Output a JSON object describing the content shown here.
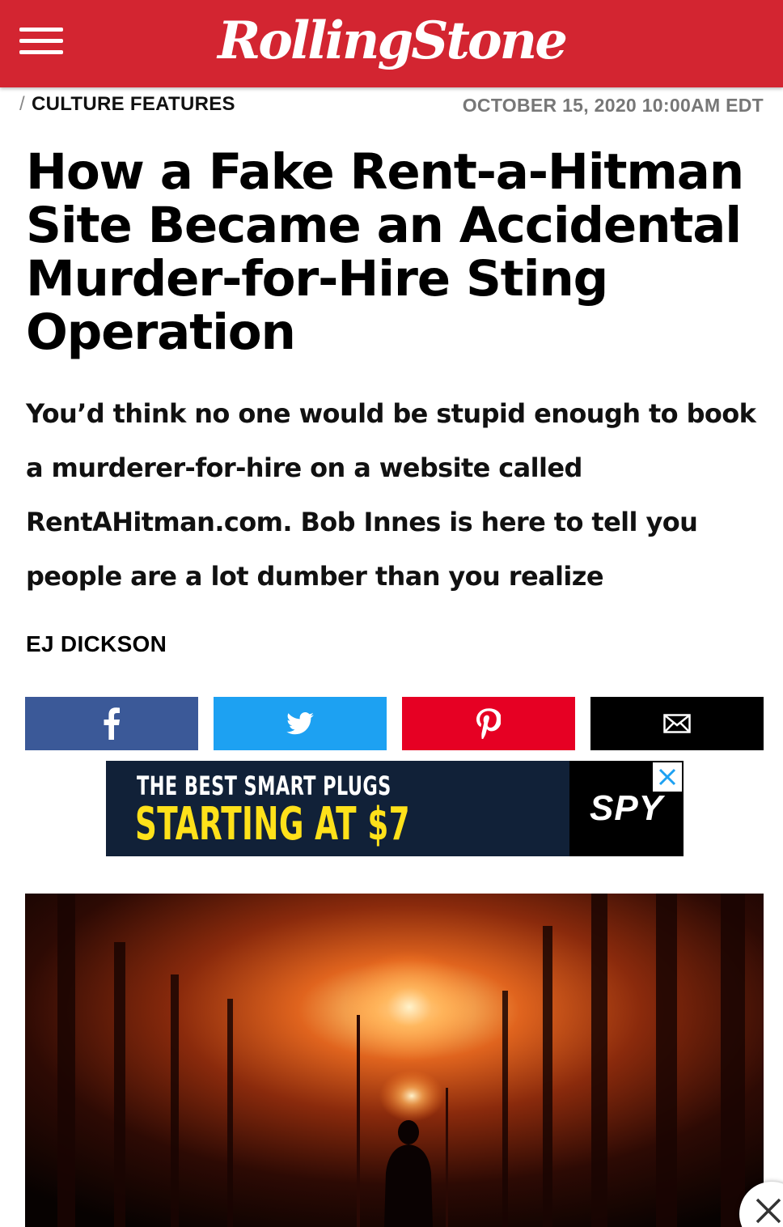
{
  "header": {
    "logo_text": "RollingStone",
    "brand_color": "#d32531"
  },
  "article": {
    "section_slash": "/",
    "section": "CULTURE FEATURES",
    "date": "OCTOBER 15, 2020 10:00AM EDT",
    "headline": "How a Fake Rent-a-Hitman Site Became an Accidental Murder-for-Hire Sting Operation",
    "dek": "You’d think no one would be stupid enough to book a murderer-for-hire on a website called RentAHitman.com. Bob Innes is here to tell you people are a lot dumber than you realize",
    "author": "EJ DICKSON"
  },
  "share": [
    {
      "name": "facebook",
      "icon": "facebook-icon",
      "color": "#3b5998"
    },
    {
      "name": "twitter",
      "icon": "twitter-icon",
      "color": "#1da1f2"
    },
    {
      "name": "pinterest",
      "icon": "pinterest-icon",
      "color": "#e60023"
    },
    {
      "name": "email",
      "icon": "mail-icon",
      "color": "#000000"
    }
  ],
  "ad": {
    "line1": "THE BEST SMART PLUGS",
    "line2": "STARTING AT $7",
    "brand": "SPY",
    "line2_color": "#ffe11a",
    "background": "#112138"
  },
  "hero": {
    "icon": "hero-photo-person-foggy-forest-streetlights"
  }
}
